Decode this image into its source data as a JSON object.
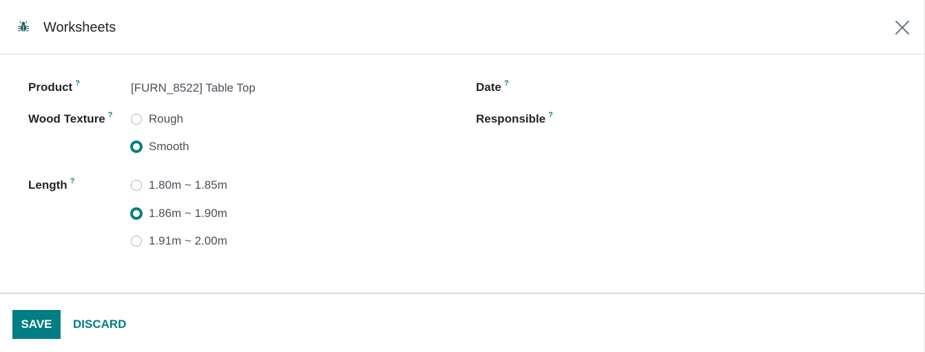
{
  "dialog": {
    "title": "Worksheets",
    "title_icon": "bug-icon",
    "close_icon": "close-icon"
  },
  "form": {
    "help_marker": "?",
    "product": {
      "label": "Product",
      "value": "[FURN_8522] Table Top"
    },
    "wood_texture": {
      "label": "Wood Texture",
      "options": [
        {
          "label": "Rough",
          "checked": false
        },
        {
          "label": "Smooth",
          "checked": true
        }
      ]
    },
    "length": {
      "label": "Length",
      "options": [
        {
          "label": "1.80m ~ 1.85m",
          "checked": false
        },
        {
          "label": "1.86m ~ 1.90m",
          "checked": true
        },
        {
          "label": "1.91m ~ 2.00m",
          "checked": false
        }
      ]
    },
    "date": {
      "label": "Date",
      "value": ""
    },
    "responsible": {
      "label": "Responsible",
      "value": ""
    }
  },
  "footer": {
    "save_label": "SAVE",
    "discard_label": "DISCARD"
  },
  "colors": {
    "accent": "#017e84",
    "text": "#212529",
    "muted_text": "#495057",
    "border": "#d8dadd"
  }
}
